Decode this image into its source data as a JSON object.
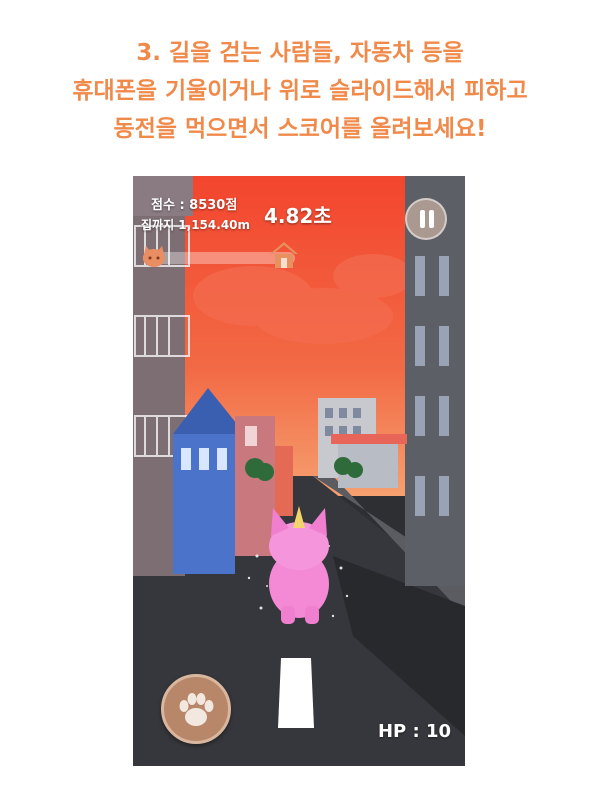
{
  "caption": {
    "line1": "3. 길을 걷는 사람들, 자동차 등을",
    "line2": "휴대폰을 기울이거나 위로 슬라이드해서 피하고",
    "line3": "동전을 먹으면서 스코어를 올려보세요!"
  },
  "hud": {
    "score": "점수 : 8530점",
    "distance": "집까지 1,154.40m",
    "timer": "4.82초",
    "hp": "HP : 10",
    "progress_fraction": 0.12
  },
  "icons": {
    "pause": "pause-icon",
    "paw": "paw-icon",
    "home": "home-icon",
    "cat": "cat-head-icon"
  },
  "colors": {
    "caption": "#f08a4b",
    "sky": "#f05a3a",
    "road": "#35363b",
    "player_cat": "#f58bd8"
  }
}
